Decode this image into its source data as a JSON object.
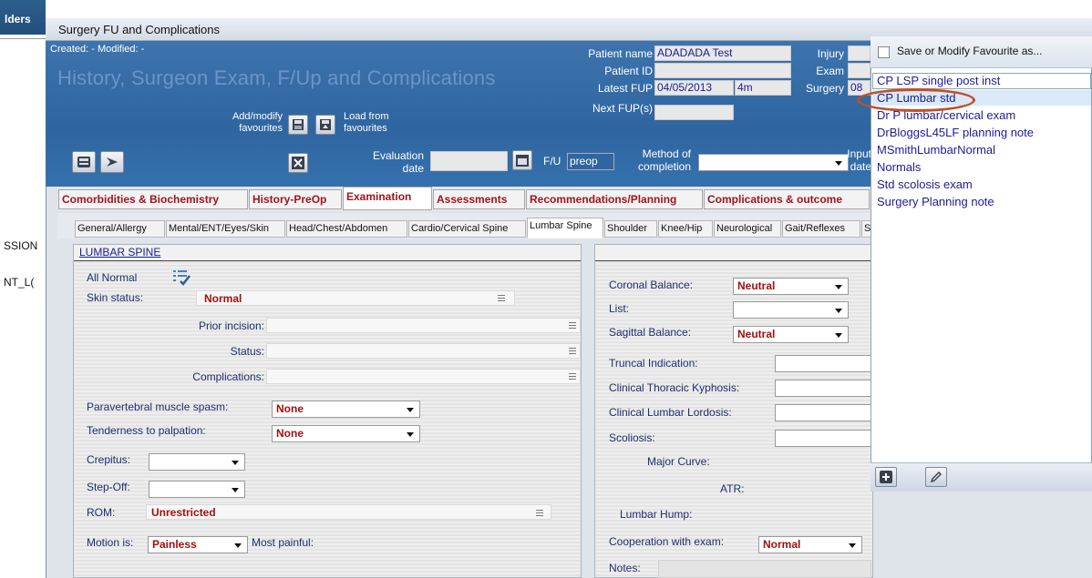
{
  "left_bg": {
    "top_text": "lders",
    "side1": "SSION",
    "side2": "NT_L("
  },
  "window_title": "Surgery FU and Complications",
  "header": {
    "created": "Created:  - Modified:  -",
    "title": "History, Surgeon Exam, F/Up and Complications",
    "add_modify": "Add/modify",
    "favourites1": "favourites",
    "load_from": "Load from",
    "favourites2": "favourites",
    "patient_name_label": "Patient name",
    "patient_name": "ADADADA Test",
    "patient_id_label": "Patient ID",
    "patient_id": "",
    "latest_fup_label": "Latest FUP",
    "latest_fup": "04/05/2013",
    "latest_fup_period": "4m",
    "next_fup_label": "Next FUP(s)",
    "next_fup": "",
    "injury_label": "Injury",
    "exam_label": "Exam",
    "surgery_label": "Surgery",
    "surgery_val": "08",
    "evaluation_label": "Evaluation",
    "date_label": "date",
    "fu_label": "F/U",
    "fu_value": "preop",
    "method_label": "Method of",
    "completion_label": "completion",
    "input_label": "Input",
    "input_date_label": "date"
  },
  "main_tabs": [
    "Comorbidities & Biochemistry",
    "History-PreOp",
    "Examination",
    "Assessments",
    "Recommendations/Planning",
    "Complications & outcome"
  ],
  "sub_tabs": [
    "General/Allergy",
    "Mental/ENT/Eyes/Skin",
    "Head/Chest/Abdomen",
    "Cardio/Cervical Spine",
    "Lumbar Spine",
    "Shoulder",
    "Knee/Hip",
    "Neurological",
    "Gait/Reflexes",
    "S"
  ],
  "lumbar": {
    "section_title": "LUMBAR SPINE",
    "all_normal": "All Normal",
    "skin_status_label": "Skin status:",
    "skin_status": "Normal",
    "prior_incision": "Prior incision:",
    "status": "Status:",
    "complications": "Complications:",
    "paravertebral": "Paravertebral muscle spasm:",
    "paravertebral_val": "None",
    "tenderness": "Tenderness to palpation:",
    "tenderness_val": "None",
    "crepitus": "Crepitus:",
    "step_off": "Step-Off:",
    "rom": "ROM:",
    "rom_val": "Unrestricted",
    "motion": "Motion is:",
    "motion_val": "Painless",
    "most_painful": "Most painful:"
  },
  "right_panel": {
    "coronal": "Coronal Balance:",
    "coronal_val": "Neutral",
    "list": "List:",
    "sagittal": "Sagittal Balance:",
    "sagittal_val": "Neutral",
    "truncal": "Truncal Indication:",
    "thoracic": "Clinical Thoracic Kyphosis:",
    "lordosis": "Clinical Lumbar Lordosis:",
    "scoliosis": "Scoliosis:",
    "major_curve": "Major Curve:",
    "atr": "ATR:",
    "lumbar_hump": "Lumbar Hump:",
    "cooperation": "Cooperation with exam:",
    "cooperation_val": "Normal",
    "notes": "Notes:"
  },
  "favourites": {
    "header": "Save or Modify Favourite as...",
    "items": [
      "CP LSP single post inst",
      "CP Lumbar std",
      "Dr P lumbar/cervical exam",
      "DrBloggsL45LF planning note",
      "MSmithLumbarNormal",
      "Normals",
      "Std scolosis exam",
      "Surgery Planning note"
    ]
  },
  "colors": {
    "header_blue": "#2f65a0",
    "tab_red": "#a0141e",
    "value_red": "#a01010",
    "highlight": "#c0502a"
  }
}
